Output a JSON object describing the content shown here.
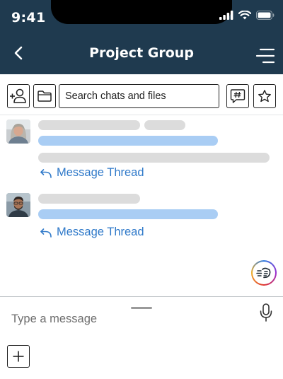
{
  "status_bar": {
    "time": "9:41"
  },
  "header": {
    "title": "Project Group"
  },
  "toolbar": {
    "search_placeholder": "Search chats and files"
  },
  "messages": [
    {
      "thread_label": "Message Thread"
    },
    {
      "thread_label": "Message Thread"
    }
  ],
  "composer": {
    "placeholder": "Type a message"
  },
  "icons": {
    "back": "chevron-left-icon",
    "menu": "menu-icon",
    "add_user": "add-user-icon",
    "folder": "folder-icon",
    "hashtag": "hashtag-chat-icon",
    "star": "star-icon",
    "thread": "reply-arrow-icon",
    "fab": "speed-hand-icon",
    "mic": "microphone-icon",
    "plus": "plus-icon"
  },
  "colors": {
    "header_bg": "#1f3a4f",
    "link_blue": "#2f79c9",
    "placeholder_gray": "#dcdcdc",
    "placeholder_blue": "#a9cdf4"
  }
}
